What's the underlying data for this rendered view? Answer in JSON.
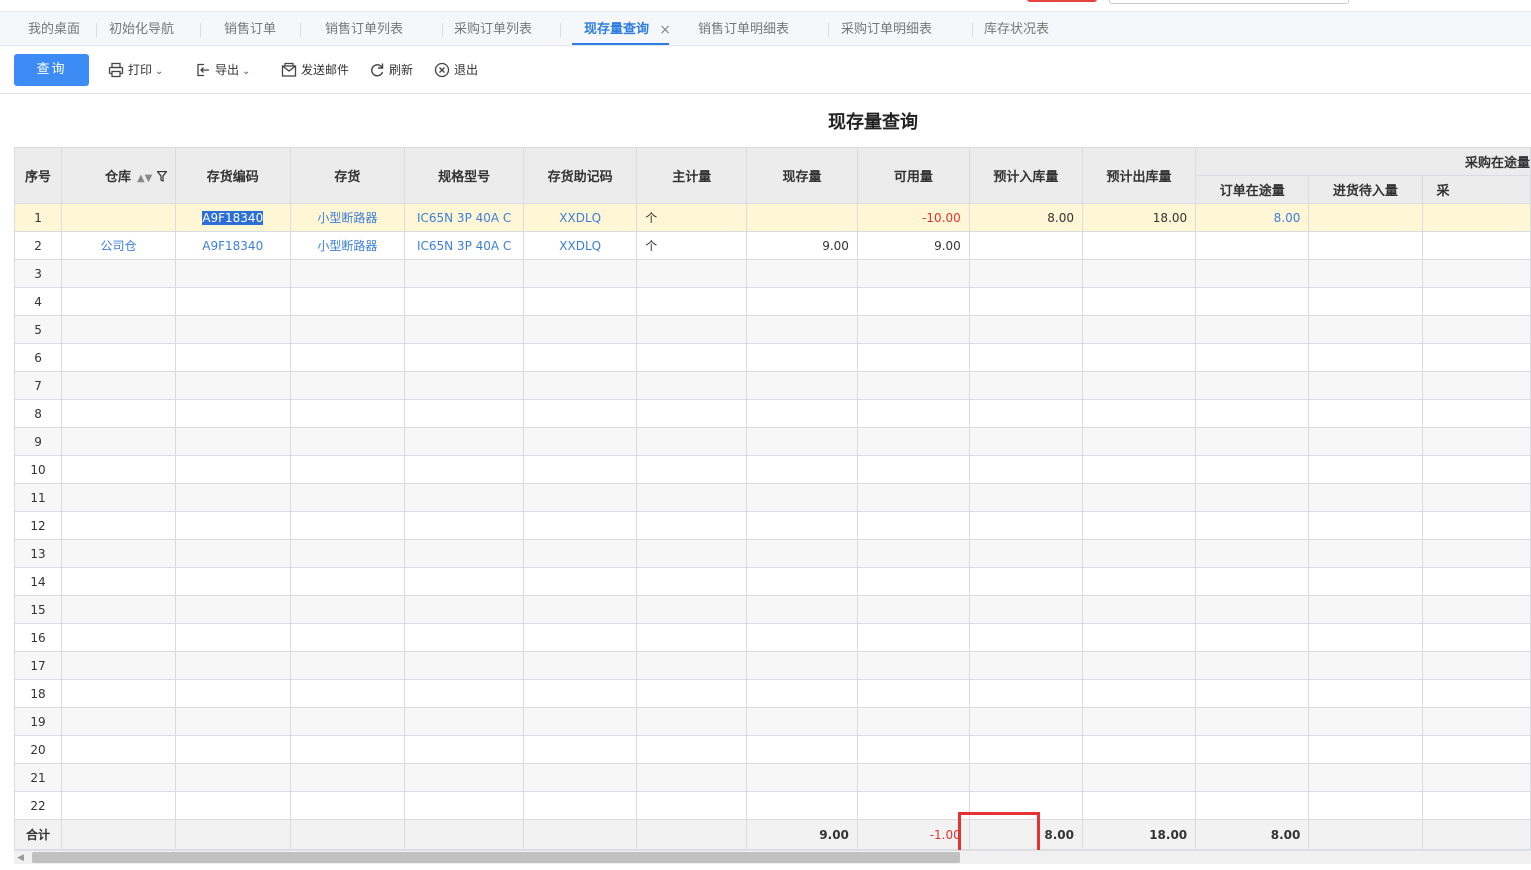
{
  "tabs": [
    "我的桌面",
    "初始化导航",
    "销售订单",
    "销售订单列表",
    "采购订单列表",
    "现存量查询",
    "销售订单明细表",
    "采购订单明细表",
    "库存状况表"
  ],
  "active_tab_close": "×",
  "toolbar": {
    "query": "查询",
    "print": "打印",
    "export": "导出",
    "send_mail": "发送邮件",
    "refresh": "刷新",
    "exit": "退出"
  },
  "report": {
    "title": "现存量查询",
    "headers": {
      "seq": "序号",
      "warehouse": "仓库",
      "code": "存货编码",
      "item": "存货",
      "spec": "规格型号",
      "mnemonic": "存货助记码",
      "unit": "主计量",
      "onhand": "现存量",
      "available": "可用量",
      "expected_in": "预计入库量",
      "expected_out": "预计出库量",
      "group_purchase": "采购在途量",
      "order_transit": "订单在途量",
      "pending_in": "进货待入量",
      "purchase_more": "采"
    },
    "rows": [
      {
        "seq": "1",
        "warehouse": "",
        "code": "A9F18340",
        "item": "小型断路器",
        "spec": "IC65N 3P 40A C",
        "mnemonic": "XXDLQ",
        "unit": "个",
        "onhand": "",
        "available": "-10.00",
        "expected_in": "8.00",
        "expected_out": "18.00",
        "order_transit": "8.00",
        "pending_in": ""
      },
      {
        "seq": "2",
        "warehouse": "公司仓",
        "code": "A9F18340",
        "item": "小型断路器",
        "spec": "IC65N 3P 40A C",
        "mnemonic": "XXDLQ",
        "unit": "个",
        "onhand": "9.00",
        "available": "9.00",
        "expected_in": "",
        "expected_out": "",
        "order_transit": "",
        "pending_in": ""
      }
    ],
    "empty_rows": [
      "3",
      "4",
      "5",
      "6",
      "7",
      "8",
      "9",
      "10",
      "11",
      "12",
      "13",
      "14",
      "15",
      "16",
      "17",
      "18",
      "19",
      "20",
      "21",
      "22"
    ],
    "total": {
      "label": "合计",
      "onhand": "9.00",
      "available": "-1.00",
      "expected_in": "8.00",
      "expected_out": "18.00",
      "order_transit": "8.00"
    }
  }
}
